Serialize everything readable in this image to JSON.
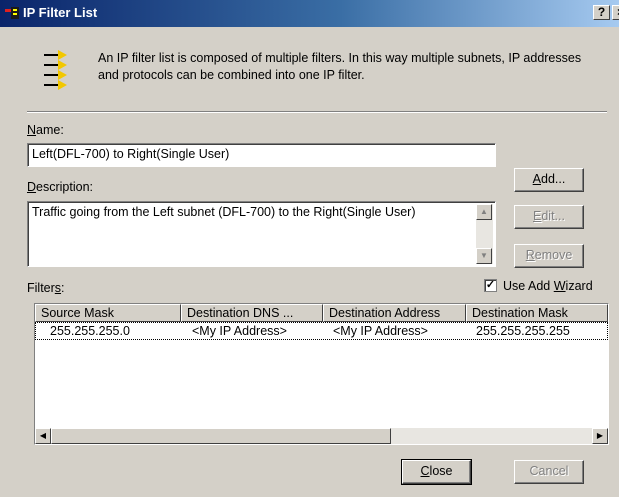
{
  "window": {
    "title": "IP Filter List",
    "help_glyph": "?",
    "close_glyph": "×"
  },
  "intro": {
    "text": "An IP filter list is composed of multiple filters. In this way multiple subnets, IP addresses and protocols can be combined into one IP filter.",
    "icon": "filter-list-icon"
  },
  "name": {
    "label_access": "N",
    "label_rest": "ame:",
    "value": "Left(DFL-700) to Right(Single User)"
  },
  "description": {
    "label_access": "D",
    "label_rest": "escription:",
    "value": "Traffic going from the Left subnet (DFL-700) to the Right(Single User)"
  },
  "buttons": {
    "add_access": "A",
    "add_rest": "dd...",
    "edit_access": "E",
    "edit_rest": "dit...",
    "remove_access": "R",
    "remove_rest": "emove",
    "close_access": "C",
    "close_rest": "lose",
    "cancel": "Cancel"
  },
  "filters": {
    "label_pre": "Filter",
    "label_access": "s",
    "label_post": ":",
    "wizard_pre": "Use Add ",
    "wizard_access": "W",
    "wizard_post": "izard",
    "wizard_checked": true,
    "columns": [
      "Source Mask",
      "Destination DNS ...",
      "Destination Address",
      "Destination Mask"
    ],
    "rows": [
      [
        "255.255.255.0",
        "<My IP Address>",
        "<My IP Address>",
        "255.255.255.255"
      ]
    ]
  },
  "colors": {
    "title_gradient_start": "#0a246a",
    "title_gradient_end": "#a6caf0",
    "face": "#d4d0c8"
  }
}
